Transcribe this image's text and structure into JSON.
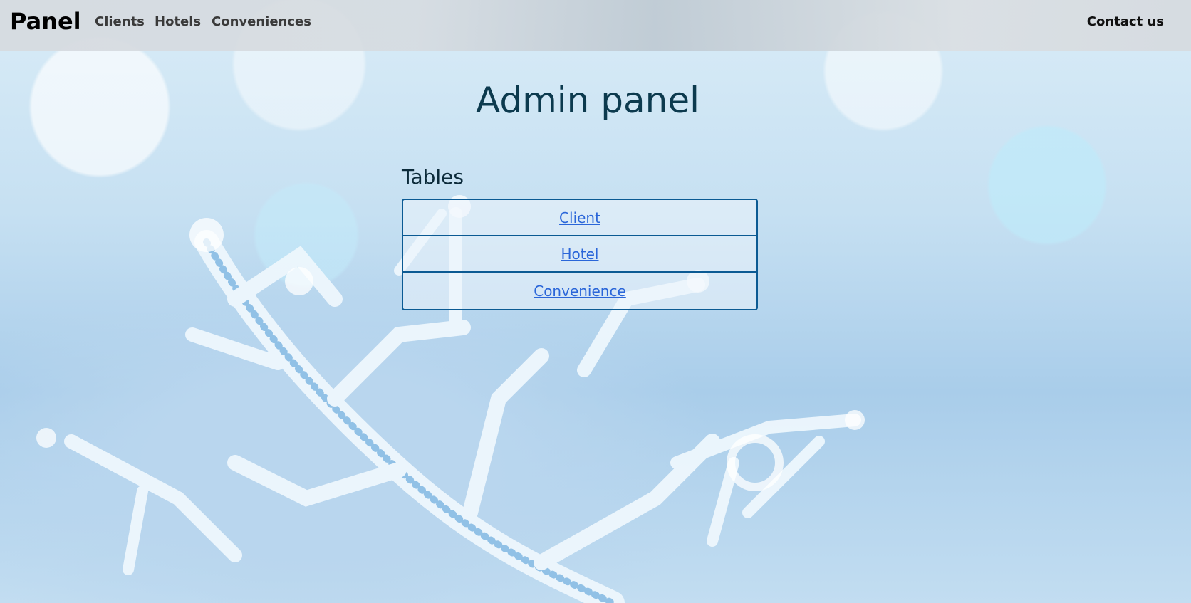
{
  "navbar": {
    "brand": "Panel",
    "links": [
      "Clients",
      "Hotels",
      "Conveniences"
    ],
    "contact": "Contact us"
  },
  "main": {
    "title": "Admin panel",
    "tables_heading": "Tables",
    "tables": [
      "Client",
      "Hotel",
      "Convenience"
    ]
  },
  "colors": {
    "title": "#0c3a4e",
    "link": "#2a66d9",
    "border": "#0b5a93"
  }
}
